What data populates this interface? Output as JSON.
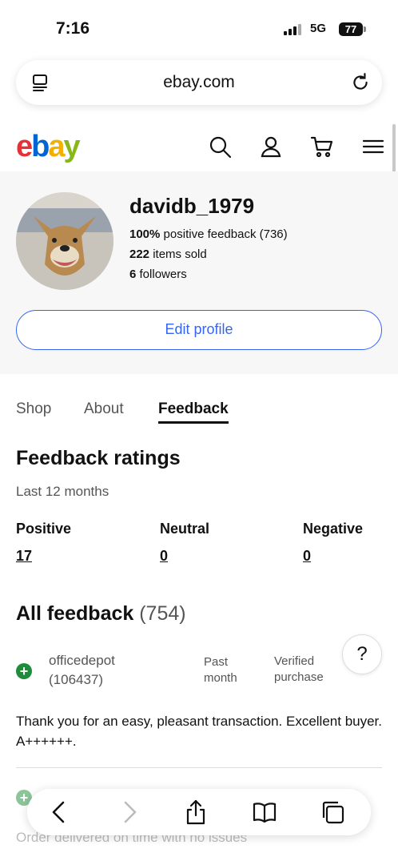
{
  "status_bar": {
    "time": "7:16",
    "network": "5G",
    "battery": "77"
  },
  "browser": {
    "url": "ebay.com"
  },
  "brand": {
    "letters": [
      "e",
      "b",
      "a",
      "y"
    ],
    "colors": [
      "#e53238",
      "#0064d2",
      "#f5af02",
      "#86b817"
    ]
  },
  "profile": {
    "username": "davidb_1979",
    "feedback_pct": "100%",
    "feedback_text": "positive feedback (736)",
    "items_sold_count": "222",
    "items_sold_text": "items sold",
    "followers_count": "6",
    "followers_text": "followers",
    "edit_label": "Edit profile"
  },
  "tabs": [
    {
      "label": "Shop",
      "active": false
    },
    {
      "label": "About",
      "active": false
    },
    {
      "label": "Feedback",
      "active": true
    }
  ],
  "ratings": {
    "title": "Feedback ratings",
    "period": "Last 12 months",
    "columns": [
      {
        "label": "Positive",
        "value": "17"
      },
      {
        "label": "Neutral",
        "value": "0"
      },
      {
        "label": "Negative",
        "value": "0"
      }
    ]
  },
  "all_feedback": {
    "title": "All feedback",
    "count": "(754)",
    "items": [
      {
        "user": "officedepot",
        "score": "(106437)",
        "time": "Past month",
        "time_line1": "Past",
        "time_line2": "month",
        "badge_line1": "Verified",
        "badge_line2": "purchase",
        "comment": "Thank you for an easy, pleasant transaction. Excellent buyer. A++++++."
      },
      {
        "comment": "Order delivered on time with no issues"
      }
    ]
  },
  "help_label": "?",
  "accent_color": "#3665f3",
  "positive_color": "#1e8c3a"
}
